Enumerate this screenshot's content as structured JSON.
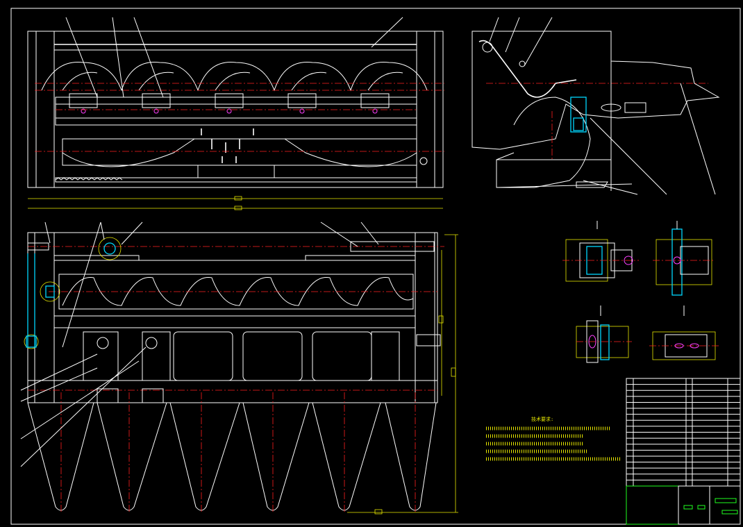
{
  "drawing": {
    "notes_title": "技术要求:",
    "notes_lines": [
      "",
      "",
      "",
      "",
      ""
    ],
    "title_block_rows": 18
  },
  "colors": {
    "background": "#000000",
    "line": "#ffffff",
    "centerline": "#ff2020",
    "dimension": "#e8e800",
    "highlight": "#00d8ff",
    "accent": "#ff40ff"
  }
}
